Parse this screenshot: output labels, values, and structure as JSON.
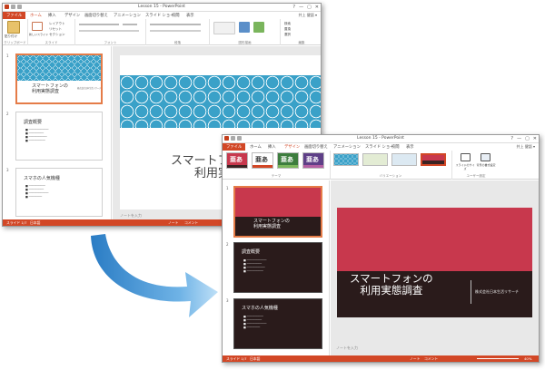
{
  "app": {
    "window_title": "Lesson 15 - PowerPoint",
    "user": "井上 健語 ▾",
    "file_tab": "ファイル",
    "tabs": [
      "ホーム",
      "挿入",
      "デザイン",
      "画面切り替え",
      "アニメーション",
      "スライド ショー",
      "校閲",
      "表示"
    ],
    "controls": [
      "?",
      "▭",
      "—",
      "▢",
      "✕"
    ]
  },
  "ribbon1": {
    "groups": [
      "クリップボード",
      "スライド",
      "フォント",
      "段落",
      "図形描画",
      "編集"
    ],
    "paste": "貼り付け",
    "new_slide": "新しいスライド",
    "layout": "レイアウト",
    "reset": "リセット",
    "section": "セクション",
    "find": "検索",
    "replace": "置換",
    "select": "選択"
  },
  "ribbon2": {
    "groups": [
      "テーマ",
      "バリエーション",
      "ユーザー設定"
    ],
    "slide_size": "スライドのサイズ",
    "bg_format": "背景の書式設定",
    "theme_glyph": "亜あ"
  },
  "slides": {
    "nums": [
      "1",
      "2",
      "3"
    ],
    "title1": "スマートフォンの利用実態調査",
    "title1_line1": "スマートフォンの",
    "title1_line2": "利用実態調査",
    "subtitle": "株式会社日本生活リサーチ",
    "title2": "調査概要",
    "title3": "スマホの人気機種"
  },
  "main1": {
    "title_line1": "スマートフォンの",
    "title_line2": "利用実態"
  },
  "status": {
    "slide": "スライド 1/7",
    "lang": "日本語",
    "notes_placeholder": "ノートを入力",
    "notes": "ノート",
    "comments": "コメント",
    "zoom": "40%"
  },
  "colors": {
    "accent": "#d24726",
    "pattern_blue": "#3aa1c8",
    "slide_red": "#c8384d",
    "slide_dark": "#2a1b1b",
    "arrow_blue": "#4f9fd9"
  }
}
